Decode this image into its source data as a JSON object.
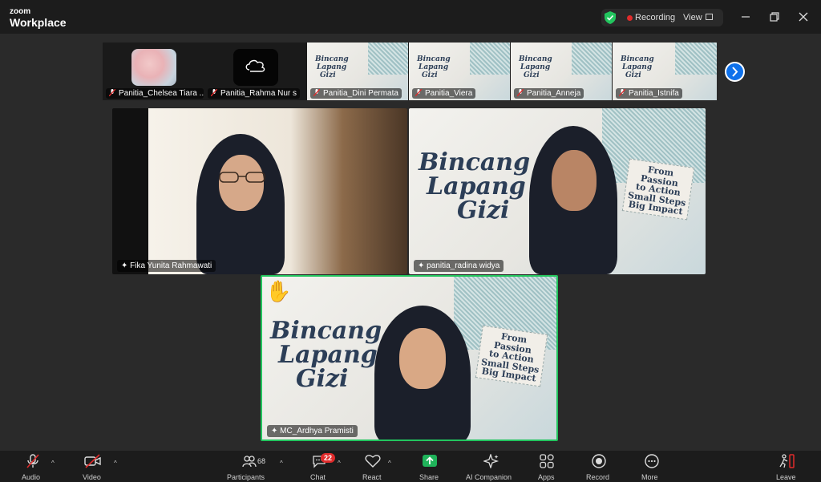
{
  "titlebar": {
    "brand_top": "zoom",
    "brand_bottom": "Workplace",
    "recording_label": "Recording",
    "view_label": "View"
  },
  "thumbnails": [
    {
      "name": "Panitia_Chelsea Tiara ...",
      "type": "avatar-flowers"
    },
    {
      "name": "Panitia_Rahma Nur s",
      "type": "avatar-cloud"
    },
    {
      "name": "Panitia_Dini Permata",
      "type": "banner"
    },
    {
      "name": "Panitia_Viera",
      "type": "banner"
    },
    {
      "name": "Panitia_Anneja",
      "type": "banner"
    },
    {
      "name": "Panitia_Istnifa",
      "type": "banner"
    }
  ],
  "tiles": {
    "fika": {
      "name": "Fika Yunita Rahmawati"
    },
    "radina": {
      "name": "panitia_radina widya"
    },
    "ardhya": {
      "name": "MC_Ardhya Pramisti",
      "reaction": "✋"
    }
  },
  "banner": {
    "line1": "Bincang",
    "line2": "Lapang",
    "line3": "Gizi",
    "card_l1": "From Passion",
    "card_l2": "to Action",
    "card_l3": "Small Steps",
    "card_l4": "Big Impact"
  },
  "toolbar": {
    "audio": "Audio",
    "video": "Video",
    "participants": "Participants",
    "participants_count": "68",
    "chat": "Chat",
    "chat_badge": "22",
    "react": "React",
    "share": "Share",
    "ai": "AI Companion",
    "apps": "Apps",
    "record": "Record",
    "more": "More",
    "leave": "Leave"
  },
  "colors": {
    "accent_green": "#22c55e",
    "share_green": "#1fb35a",
    "recording_red": "#e02b2b",
    "nav_blue": "#0e71eb"
  }
}
